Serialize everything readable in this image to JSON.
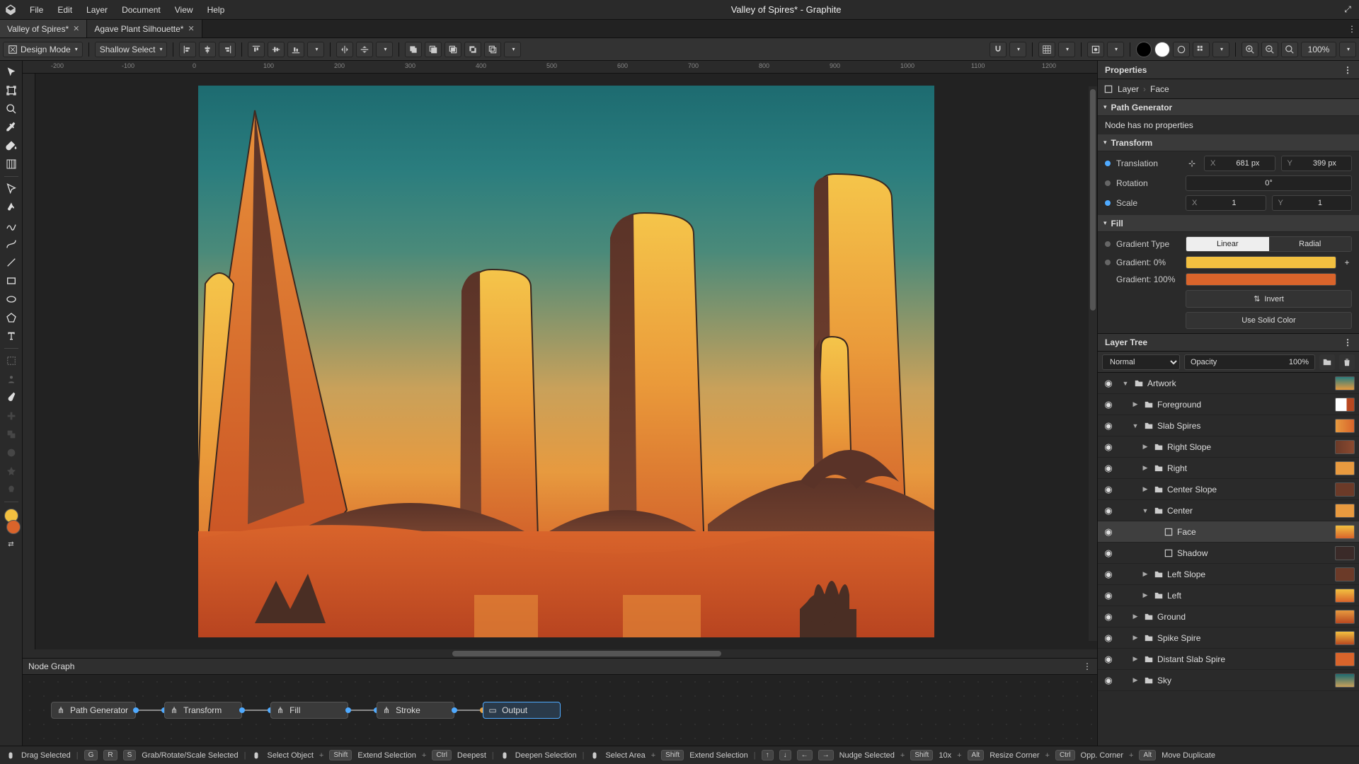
{
  "app": {
    "title": "Valley of Spires* - Graphite"
  },
  "menu": [
    "File",
    "Edit",
    "Layer",
    "Document",
    "View",
    "Help"
  ],
  "tabs": [
    {
      "label": "Valley of Spires*",
      "active": true
    },
    {
      "label": "Agave Plant Silhouette*",
      "active": false
    }
  ],
  "toolbar": {
    "mode": "Design Mode",
    "select": "Shallow Select",
    "zoom": "100%"
  },
  "ruler": [
    "-200",
    "-100",
    "0",
    "100",
    "200",
    "300",
    "400",
    "500",
    "600",
    "700",
    "800",
    "900",
    "1000",
    "1100",
    "1200"
  ],
  "properties": {
    "title": "Properties",
    "breadcrumb": [
      "Layer",
      "Face"
    ],
    "path_gen": {
      "title": "Path Generator",
      "msg": "Node has no properties"
    },
    "transform": {
      "title": "Transform",
      "translation": {
        "label": "Translation",
        "x": "681 px",
        "y": "399 px"
      },
      "rotation": {
        "label": "Rotation",
        "val": "0°"
      },
      "scale": {
        "label": "Scale",
        "x": "1",
        "y": "1"
      }
    },
    "fill": {
      "title": "Fill",
      "grad_type": {
        "label": "Gradient Type",
        "linear": "Linear",
        "radial": "Radial"
      },
      "grad0": "Gradient: 0%",
      "grad100": "Gradient: 100%",
      "invert": "Invert",
      "solid": "Use Solid Color",
      "color0": "#f2c040",
      "color100": "#d9642b"
    }
  },
  "layertree": {
    "title": "Layer Tree",
    "blend": "Normal",
    "opacity_label": "Opacity",
    "opacity_val": "100%",
    "layers": [
      {
        "depth": 0,
        "exp": "▼",
        "type": "folder",
        "name": "Artwork",
        "thumb": "linear-gradient(180deg,#2a7d7e,#e79a3f)"
      },
      {
        "depth": 1,
        "exp": "▶",
        "type": "folder",
        "name": "Foreground",
        "thumb": "linear-gradient(90deg,#fff 60%,#b84820 60%)"
      },
      {
        "depth": 1,
        "exp": "▼",
        "type": "folder",
        "name": "Slab Spires",
        "thumb": "linear-gradient(90deg,#e79a3f,#d9642b)"
      },
      {
        "depth": 2,
        "exp": "▶",
        "type": "folder",
        "name": "Right Slope",
        "thumb": "linear-gradient(90deg,#6b3a28,#8b4a30)"
      },
      {
        "depth": 2,
        "exp": "▶",
        "type": "folder",
        "name": "Right",
        "thumb": "#e89a3f"
      },
      {
        "depth": 2,
        "exp": "▶",
        "type": "folder",
        "name": "Center Slope",
        "thumb": "#6b3a28"
      },
      {
        "depth": 2,
        "exp": "▼",
        "type": "folder",
        "name": "Center",
        "thumb": "#e89a3f",
        "selected": false
      },
      {
        "depth": 3,
        "exp": "",
        "type": "shape",
        "name": "Face",
        "thumb": "linear-gradient(180deg,#f2c040,#d9642b)",
        "selected": true
      },
      {
        "depth": 3,
        "exp": "",
        "type": "shape",
        "name": "Shadow",
        "thumb": "#3a2a28"
      },
      {
        "depth": 2,
        "exp": "▶",
        "type": "folder",
        "name": "Left Slope",
        "thumb": "#6b3a28"
      },
      {
        "depth": 2,
        "exp": "▶",
        "type": "folder",
        "name": "Left",
        "thumb": "linear-gradient(180deg,#f2c040,#d9642b)"
      },
      {
        "depth": 1,
        "exp": "▶",
        "type": "folder",
        "name": "Ground",
        "thumb": "linear-gradient(180deg,#e79a3f,#b84820)"
      },
      {
        "depth": 1,
        "exp": "▶",
        "type": "folder",
        "name": "Spike Spire",
        "thumb": "linear-gradient(180deg,#f2c040,#b84820)"
      },
      {
        "depth": 1,
        "exp": "▶",
        "type": "folder",
        "name": "Distant Slab Spire",
        "thumb": "#d9642b"
      },
      {
        "depth": 1,
        "exp": "▶",
        "type": "folder",
        "name": "Sky",
        "thumb": "linear-gradient(180deg,#1d6b70,#c9a15a)"
      }
    ]
  },
  "nodegraph": {
    "title": "Node Graph",
    "nodes": [
      "Path Generator",
      "Transform",
      "Fill",
      "Stroke",
      "Output"
    ]
  },
  "status": {
    "hints": [
      {
        "keys": [
          "⬚"
        ],
        "text": "Drag Selected"
      },
      {
        "keys": [
          "G",
          "R",
          "S"
        ],
        "text": "Grab/Rotate/Scale Selected"
      },
      {
        "keys": [
          "⬚"
        ],
        "text": "Select Object",
        "plus": true
      },
      {
        "keys": [
          "Shift"
        ],
        "text": "Extend Selection",
        "plus": true
      },
      {
        "keys": [
          "Ctrl"
        ],
        "text": "Deepest"
      },
      {
        "keys": [
          "⬚"
        ],
        "text": "Deepen Selection"
      },
      {
        "keys": [
          "⬚"
        ],
        "text": "Select Area",
        "plus": true
      },
      {
        "keys": [
          "Shift"
        ],
        "text": "Extend Selection"
      },
      {
        "keys": [
          "↑",
          "↓",
          "←",
          "→"
        ],
        "text": "Nudge Selected",
        "plus": true
      },
      {
        "keys": [
          "Shift"
        ],
        "text": "10x",
        "plus": true
      },
      {
        "keys": [
          "Alt"
        ],
        "text": "Resize Corner",
        "plus": true
      },
      {
        "keys": [
          "Ctrl"
        ],
        "text": "Opp. Corner",
        "plus": true
      },
      {
        "keys": [
          "Alt"
        ],
        "text": "Move Duplicate"
      }
    ]
  }
}
